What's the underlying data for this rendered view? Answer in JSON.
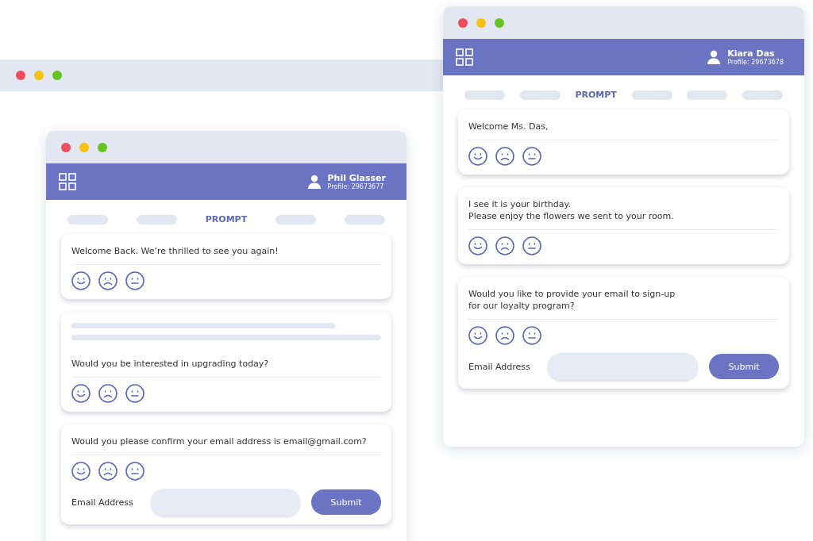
{
  "windows": [
    {
      "user": {
        "name": "Phil Glasser",
        "profile": "Profile: 29673677"
      },
      "tabs": [
        {
          "selected": false
        },
        {
          "selected": false
        },
        {
          "label": "PROMPT",
          "selected": true
        },
        {
          "selected": false
        },
        {
          "selected": false
        }
      ],
      "cards": [
        {
          "skeleton": false,
          "text": "Welcome Back. We’re thrilled to see you again!"
        },
        {
          "skeleton": true,
          "text": "Would you be interested in upgrading today?"
        },
        {
          "skeleton": false,
          "text": "Would you please confirm your email address is email@gmail.com?",
          "email": {
            "label": "Email Address",
            "button": "Submit"
          }
        }
      ]
    },
    {
      "user": {
        "name": "Kiara Das",
        "profile": "Profile: 29673678"
      },
      "tabs": [
        {
          "selected": false
        },
        {
          "selected": false
        },
        {
          "label": "PROMPT",
          "selected": true
        },
        {
          "selected": false
        },
        {
          "selected": false
        },
        {
          "selected": false
        }
      ],
      "cards": [
        {
          "skeleton": false,
          "text": "Welcome Ms. Das,"
        },
        {
          "skeleton": false,
          "text": "I see it is your birthday.\nPlease enjoy the flowers we sent to your room."
        },
        {
          "skeleton": false,
          "text": "Would you like to provide your email to sign-up\nfor our loyalty program?",
          "email": {
            "label": "Email Address",
            "button": "Submit"
          }
        }
      ]
    }
  ]
}
